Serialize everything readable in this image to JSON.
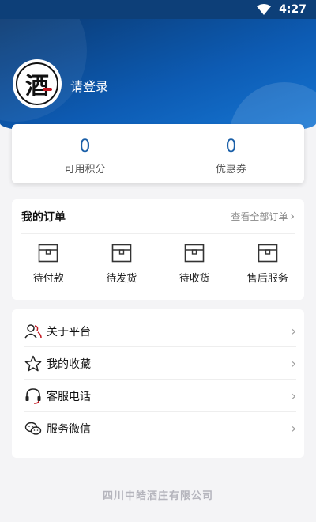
{
  "status_bar": {
    "time": "4:27",
    "wifi_icon": "wifi-icon"
  },
  "profile": {
    "login_text": "请登录",
    "avatar_char": "酒"
  },
  "stats": [
    {
      "value": "0",
      "label": "可用积分"
    },
    {
      "value": "0",
      "label": "优惠券"
    }
  ],
  "orders": {
    "title": "我的订单",
    "view_all": "查看全部订单",
    "items": [
      {
        "label": "待付款",
        "icon": "box-icon"
      },
      {
        "label": "待发货",
        "icon": "box-icon"
      },
      {
        "label": "待收货",
        "icon": "box-icon"
      },
      {
        "label": "售后服务",
        "icon": "box-icon"
      }
    ]
  },
  "menu": [
    {
      "label": "关于平台",
      "icon": "users-icon"
    },
    {
      "label": "我的收藏",
      "icon": "star-icon"
    },
    {
      "label": "客服电话",
      "icon": "headset-icon"
    },
    {
      "label": "服务微信",
      "icon": "wechat-icon"
    }
  ],
  "footer": {
    "company": "四川中皓酒庄有限公司"
  },
  "colors": {
    "primary": "#0d5bb3",
    "accent": "#1a5fa8",
    "background": "#f4f4f6"
  }
}
